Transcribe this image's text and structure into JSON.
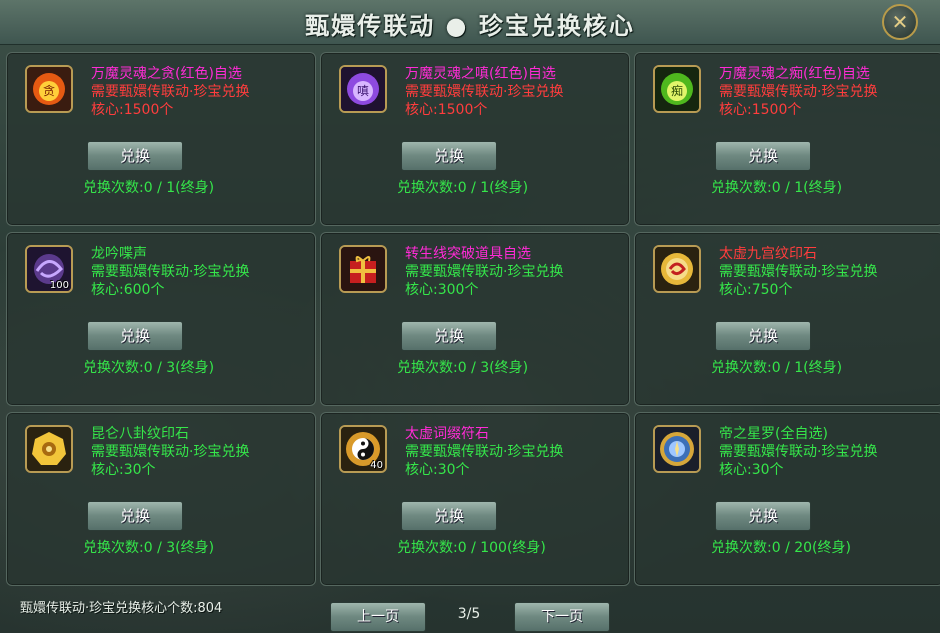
{
  "title": "甄嬛传联动 ● 珍宝兑换核心",
  "colors": {
    "red": "#ff3d3d",
    "green": "#35e64a",
    "purple": "#ff2bd6"
  },
  "items": [
    {
      "name": "万魔灵魂之贪(红色)自选",
      "name_color": "#ff2bd6",
      "req_line1": "需要甄嬛传联动·珍宝兑换",
      "req_line2": "核心:1500个",
      "sufficient": false,
      "button": "兑换",
      "count": "兑换次数:0 / 1(终身)",
      "icon": "greed-soul-icon",
      "badge": ""
    },
    {
      "name": "万魔灵魂之嗔(红色)自选",
      "name_color": "#ff2bd6",
      "req_line1": "需要甄嬛传联动·珍宝兑换",
      "req_line2": "核心:1500个",
      "sufficient": false,
      "button": "兑换",
      "count": "兑换次数:0 / 1(终身)",
      "icon": "anger-soul-icon",
      "badge": ""
    },
    {
      "name": "万魔灵魂之痴(红色)自选",
      "name_color": "#ff2bd6",
      "req_line1": "需要甄嬛传联动·珍宝兑换",
      "req_line2": "核心:1500个",
      "sufficient": false,
      "button": "兑换",
      "count": "兑换次数:0 / 1(终身)",
      "icon": "delusion-soul-icon",
      "badge": ""
    },
    {
      "name": "龙吟喋声",
      "name_color": "#35e64a",
      "req_line1": "需要甄嬛传联动·珍宝兑换",
      "req_line2": "核心:600个",
      "sufficient": true,
      "button": "兑换",
      "count": "兑换次数:0 / 3(终身)",
      "icon": "dragon-orb-icon",
      "badge": "100"
    },
    {
      "name": "转生线突破道具自选",
      "name_color": "#ff2bd6",
      "req_line1": "需要甄嬛传联动·珍宝兑换",
      "req_line2": "核心:300个",
      "sufficient": true,
      "button": "兑换",
      "count": "兑换次数:0 / 3(终身)",
      "icon": "gift-box-icon",
      "badge": ""
    },
    {
      "name": "太虚九宫纹印石",
      "name_color": "#ff3d3d",
      "req_line1": "需要甄嬛传联动·珍宝兑换",
      "req_line2": "核心:750个",
      "sufficient": true,
      "button": "兑换",
      "count": "兑换次数:0 / 1(终身)",
      "icon": "seal-stone-icon",
      "badge": ""
    },
    {
      "name": "昆仑八卦纹印石",
      "name_color": "#35e64a",
      "req_line1": "需要甄嬛传联动·珍宝兑换",
      "req_line2": "核心:30个",
      "sufficient": true,
      "button": "兑换",
      "count": "兑换次数:0 / 3(终身)",
      "icon": "bagua-stone-icon",
      "badge": ""
    },
    {
      "name": "太虚词缀符石",
      "name_color": "#ff2bd6",
      "req_line1": "需要甄嬛传联动·珍宝兑换",
      "req_line2": "核心:30个",
      "sufficient": true,
      "button": "兑换",
      "count": "兑换次数:0 / 100(终身)",
      "icon": "yinyang-rune-icon",
      "badge": "40"
    },
    {
      "name": "帝之星罗(全自选)",
      "name_color": "#35e64a",
      "req_line1": "需要甄嬛传联动·珍宝兑换",
      "req_line2": "核心:30个",
      "sufficient": true,
      "button": "兑换",
      "count": "兑换次数:0 / 20(终身)",
      "icon": "star-compass-icon",
      "badge": ""
    }
  ],
  "footer": {
    "total_label": "甄嬛传联动·珍宝兑换核心个数:804",
    "prev": "上一页",
    "next": "下一页",
    "page": "3/5"
  }
}
